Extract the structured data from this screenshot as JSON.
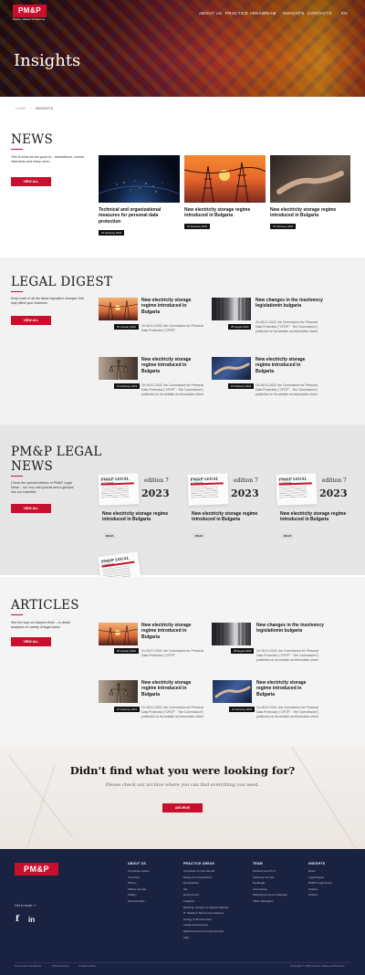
{
  "brand": {
    "logo": "PM&P",
    "tagline": "Pavlov, Mateev & Partners",
    "accent": "#c8102e",
    "footer_bg": "#1a2242"
  },
  "nav": {
    "items": [
      "ABOUT US",
      "PRACTICE AREAS",
      "TEAM",
      "INSIGHTS",
      "CONTACTS",
      "EN"
    ]
  },
  "hero": {
    "title": "Insights"
  },
  "breadcrumb": {
    "home": "HOME",
    "current": "INSIGHTS"
  },
  "news": {
    "title": "NEWS",
    "desc": "This is what we are good at – transactions, events, interviews and many more.",
    "button": "VIEW ALL",
    "cards": [
      {
        "title": "Technical and organizational measures for personal data protection",
        "date": "15 February 2023"
      },
      {
        "title": "New electricity storage regime introduced in Bulgaria",
        "date": "15 February 2023"
      },
      {
        "title": "New electricity storage regime introduced in Bulgaria",
        "date": "15 February 2023"
      }
    ]
  },
  "legal_digest": {
    "title": "LEGAL DIGEST",
    "desc": "Keep track of all the latest legislative changes that may affect your business",
    "button": "VIEW ALL",
    "items": [
      {
        "title": "New electricity storage regime introduced in Bulgaria",
        "date": "25 January 2023",
        "text": "On 26.01.2023, the Commission for Personal Data Protection (\"CPDP\"."
      },
      {
        "title": "New changes in the insolvency legislationin bulgaria",
        "date": "28 August 2023",
        "text": "On 26.01.2023, the Commission for Personal Data Protection (\"CPDP\" : \"the Commission\") published on its website an information sheet"
      },
      {
        "title": "New electricity storage regime introduced in Bulgaria",
        "date": "15 February 2023",
        "text": "On 26.01.2023, the Commission for Personal Data Protection (\"CPDP\" : \"the Commission\") published on its website an information sheet"
      },
      {
        "title": "New electricity storage regime introduced in Bulgaria",
        "date": "15 February 2023",
        "text": "On 26.01.2023, the Commission for Personal Data Protection (\"CPDP\" : \"the Commission\") published on its website an information sheet"
      }
    ]
  },
  "legal_news": {
    "title_line1": "PM&P LEGAL",
    "title_line2": "NEWS",
    "desc": "Check the special editions of PM&P Legal News – our very own journal and a glimpse into our expertise",
    "button": "VIEW ALL",
    "masthead": "PM&P LEGAL NEWS",
    "edition": "edition 7",
    "year": "2023",
    "cards": [
      {
        "title": "New electricity storage regime introduced in Bulgaria",
        "read": "READ"
      },
      {
        "title": "New electricity storage regime introduced in Bulgaria",
        "read": "READ"
      },
      {
        "title": "New electricity storage regime introduced in Bulgaria",
        "read": "READ"
      }
    ]
  },
  "articles": {
    "title": "ARTICLES",
    "desc": "See the way our lawyers think – in-depth analyses on variety of legal topics",
    "button": "VIEW ALL",
    "items": [
      {
        "title": "New electricity storage regime introduced in Bulgaria",
        "date": "25 January 2023",
        "text": "On 26.01.2023, the Commission for Personal Data Protection (\"CPDP\"."
      },
      {
        "title": "New changes in the insolvency legislationin bulgaria",
        "date": "28 August 2023",
        "text": "On 26.01.2023, the Commission for Personal Data Protection (\"CPDP\" : \"the Commission\") published on its website an information sheet"
      },
      {
        "title": "New electricity storage regime introduced in Bulgaria",
        "date": "15 February 2023",
        "text": "On 26.01.2023, the Commission for Personal Data Protection (\"CPDP\" : \"the Commission\") published on its website an information sheet"
      },
      {
        "title": "New electricity storage regime introduced in Bulgaria",
        "date": "15 February 2023",
        "text": "On 26.01.2023, the Commission for Personal Data Protection (\"CPDP\" : \"the Commission\") published on its website an information sheet"
      }
    ]
  },
  "cta": {
    "title": "Didn't find what you were looking for?",
    "subtitle": "Please check our archive where you can find everything you need.",
    "button": "ARCHIVE"
  },
  "footer": {
    "get_in_touch": "Get in touch ↗",
    "cols": [
      {
        "h": "ABOUT US",
        "items": [
          "Corporate values",
          "Overview",
          "History",
          "Offices abroad",
          "Gallery",
          "Memberships"
        ]
      },
      {
        "h": "PRACTICE AREAS",
        "items": [
          "Corporate & Commercial",
          "Mergers & Acquisitions",
          "Renewables",
          "Tax",
          "Employment",
          "Litigation",
          "Banking, Finance & Capital Markets",
          "IT, Media & Telecommunications",
          "Energy & Environment",
          "Intellectual property",
          "Data Protection & Cybersecurity",
          "AML"
        ]
      },
      {
        "h": "TEAM",
        "items": [
          "Partners and Of C",
          "Attorneys at Law",
          "Paralegal",
          "Accounting",
          "Marketing & Event Manager",
          "Office Managers"
        ]
      },
      {
        "h": "INSIGHTS",
        "items": [
          "News",
          "Legal Digest",
          "PM&P Legal News",
          "Articles",
          "Archive"
        ]
      }
    ],
    "bottom_links": [
      "Terms and Conditions",
      "Privacy Policy",
      "Cookies Policy"
    ],
    "copyright": "Copyright © 2023 Pavlov, Mateev & Partners"
  }
}
